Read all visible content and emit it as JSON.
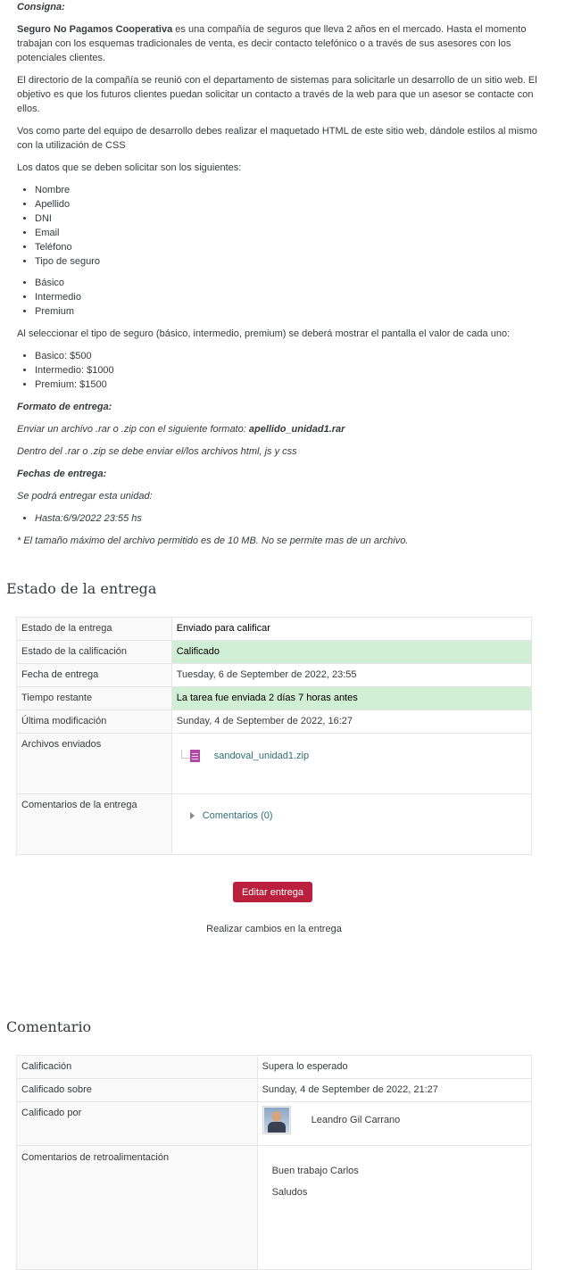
{
  "intro": {
    "consigna_label": "Consigna:",
    "company_name": "Seguro No Pagamos Cooperativa",
    "p1_rest": " es una compañía de seguros que lleva 2 años en el mercado. Hasta el momento trabajan con los esquemas tradicionales de venta, es decir contacto telefónico o a través de sus asesores con los potenciales clientes.",
    "p2": "El directorio de la compañía se reunió con el departamento de sistemas para solicitarle un desarrollo de un sitio web. El objetivo es que los futuros clientes puedan solicitar un contacto a través de la web para que un asesor se contacte con ellos.",
    "p3": "Vos como parte del equipo de desarrollo debes realizar el maquetado HTML de este sitio web, dándole estilos al mismo con la utilización de CSS",
    "p4": "Los datos que se deben solicitar son los siguientes:",
    "fields": [
      "Nombre",
      "Apellido",
      "DNI",
      "Email",
      "Teléfono",
      "Tipo de seguro"
    ],
    "insurance_types": [
      "Básico",
      "Intermedio",
      "Premium"
    ],
    "p5": " Al seleccionar el tipo de seguro (básico, intermedio, premium) se deberá mostrar el pantalla el valor de cada uno:",
    "prices": [
      "Basico: $500",
      "Intermedio: $1000",
      "Premium: $1500"
    ],
    "formato_label": "Formato de entrega:",
    "formato_text": "Enviar un archivo .rar o .zip con el siguiente formato: ",
    "formato_name": "apellido_unidad1.rar",
    "dentro_text": "Dentro del .rar o .zip se debe enviar el/los archivos html, js y css",
    "fechas_label": "Fechas de entrega:",
    "podra_text": "Se podrá entregar esta unidad:",
    "hasta": "Hasta:6/9/2022 23:55 hs",
    "note": "* El tamaño máximo del archivo permitido es de 10 MB. No se permite mas de un archivo."
  },
  "submission": {
    "heading": "Estado de la entrega",
    "rows": {
      "status_label": "Estado de la entrega",
      "status_value": "Enviado para calificar",
      "grading_label": "Estado de la calificación",
      "grading_value": "Calificado",
      "due_label": "Fecha de entrega",
      "due_value": "Tuesday, 6 de September de 2022, 23:55",
      "remaining_label": "Tiempo restante",
      "remaining_value": "La tarea fue enviada 2 días 7 horas antes",
      "modified_label": "Última modificación",
      "modified_value": "Sunday, 4 de September de 2022, 16:27",
      "files_label": "Archivos enviados",
      "file_name": "sandoval_unidad1.zip",
      "comments_label": "Comentarios de la entrega",
      "comments_link": "Comentarios (0)"
    },
    "edit_button": "Editar entrega",
    "edit_desc": "Realizar cambios en la entrega"
  },
  "feedback": {
    "heading": "Comentario",
    "grade_label": "Calificación",
    "grade_value": "Supera lo esperado",
    "graded_on_label": "Calificado sobre",
    "graded_on_value": "Sunday, 4 de September de 2022, 21:27",
    "graded_by_label": "Calificado por",
    "grader_name": "Leandro Gil Carrano",
    "feedback_label": "Comentarios de retroalimentación",
    "feedback_line1": "Buen trabajo Carlos",
    "feedback_line2": "Saludos"
  },
  "colors": {
    "accent_button": "#ba1f3e",
    "success_bg": "#d0efd4",
    "link": "#2f6e75"
  },
  "icons": {
    "file": "archive-file-icon",
    "toggle": "expand-triangle-icon",
    "avatar": "user-avatar"
  }
}
